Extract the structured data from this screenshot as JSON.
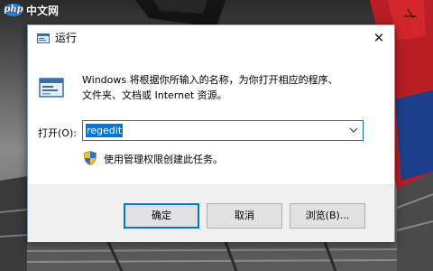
{
  "watermark": {
    "logo": "php",
    "text": "中文网"
  },
  "dialog": {
    "title": "运行",
    "close_symbol": "✕",
    "description_line1": "Windows 将根据你所输入的名称，为你打开相应的程序、",
    "description_line2": "文件夹、文档或 Internet 资源。",
    "open_label": "打开(O):",
    "open_value": "regedit",
    "admin_note": "使用管理权限创建此任务。",
    "buttons": {
      "ok": "确定",
      "cancel": "取消",
      "browse": "浏览(B)..."
    },
    "icons": {
      "title": "run-icon",
      "large": "run-icon",
      "dropdown": "chevron-down-icon",
      "admin": "shield-icon",
      "close": "close-icon"
    }
  },
  "colors": {
    "accent": "#0078d7",
    "footer": "#f0f0f0",
    "button": "#e1e1e1",
    "dialog_border": "#7a9bc7"
  }
}
